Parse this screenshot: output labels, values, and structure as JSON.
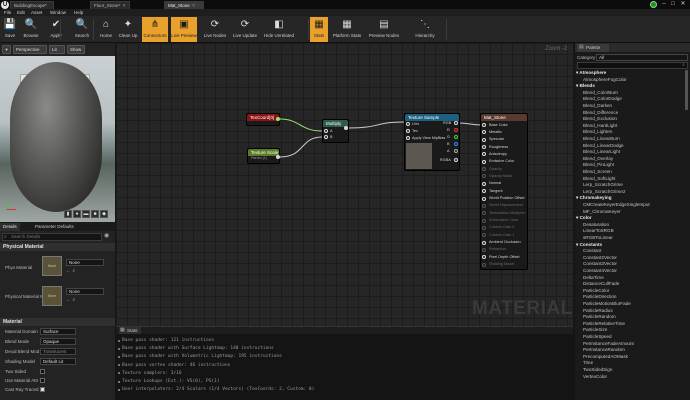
{
  "window": {
    "tabs": [
      {
        "label": "BuildingEscape*",
        "active": false
      },
      {
        "label": "Floor_Stone*",
        "active": false
      },
      {
        "label": "Mat_Stone",
        "active": true
      }
    ],
    "controls": {
      "minimize": "–",
      "maximize": "□",
      "close": "✕"
    }
  },
  "menu": {
    "items": [
      "File",
      "Edit",
      "Asset",
      "Window",
      "Help"
    ]
  },
  "toolbar": {
    "buttons": [
      {
        "label": "Save",
        "icon": "💾",
        "highlighted": false
      },
      {
        "label": "Browse",
        "icon": "🔍",
        "highlighted": false
      },
      {
        "label": "Apply",
        "icon": "✔",
        "highlighted": false
      },
      {
        "label": "Search",
        "icon": "🔍",
        "highlighted": false
      },
      {
        "label": "Home",
        "icon": "⌂",
        "highlighted": false
      },
      {
        "label": "Clean Up",
        "icon": "✦",
        "highlighted": false
      },
      {
        "label": "Connectors",
        "icon": "⋔",
        "highlighted": true
      },
      {
        "label": "Live Preview",
        "icon": "▣",
        "highlighted": true
      },
      {
        "label": "Live Nodes",
        "icon": "⟳",
        "highlighted": false
      },
      {
        "label": "Live Update",
        "icon": "⟳",
        "highlighted": false
      },
      {
        "label": "Hide Unrelated",
        "icon": "◧",
        "highlighted": false
      },
      {
        "label": "Stats",
        "icon": "▦",
        "highlighted": true
      },
      {
        "label": "Platform Stats",
        "icon": "▦",
        "highlighted": false
      },
      {
        "label": "Preview Nodes",
        "icon": "▤",
        "highlighted": false
      },
      {
        "label": "Hierarchy",
        "icon": "⋱",
        "highlighted": false
      }
    ]
  },
  "viewport": {
    "perspective_label": "Perspective",
    "lit_label": "Lit",
    "show_label": "Show"
  },
  "details": {
    "tabs": [
      {
        "label": "Details",
        "active": true
      },
      {
        "label": "Parameter Defaults",
        "active": false
      }
    ],
    "search_placeholder": "Search Details",
    "physical_material": {
      "header": "Physical Material",
      "rows": [
        {
          "label": "Phys Material",
          "thumb": "None",
          "value": "None"
        },
        {
          "label": "Physical Material M",
          "thumb": "None",
          "value": "None"
        }
      ]
    },
    "material": {
      "header": "Material",
      "rows": [
        {
          "label": "Material Domain",
          "value": "Surface"
        },
        {
          "label": "Blend Mode",
          "value": "Opaque"
        },
        {
          "label": "Decal Blend Mod",
          "value": "Translucent"
        },
        {
          "label": "Shading Model",
          "value": "Default Lit"
        },
        {
          "label": "Two Sided",
          "value": ""
        },
        {
          "label": "Use Material Attr",
          "value": ""
        },
        {
          "label": "Cast Ray Traced",
          "value": ""
        }
      ]
    }
  },
  "graph": {
    "zoom": "Zoom -2",
    "watermark": "MATERIAL",
    "nodes": {
      "texcoord": {
        "title": "TexCoord[0]"
      },
      "texturescale": {
        "title": "Texture Scale",
        "value": "Param (1)"
      },
      "multiply": {
        "title": "Multiply",
        "pins": [
          "A",
          "B"
        ]
      },
      "texturesample": {
        "title": "Texture Sample",
        "inputs": [
          "UVs",
          "Tex",
          "Apply View MipBias"
        ],
        "outputs": [
          "RGB",
          "R",
          "G",
          "B",
          "A",
          "RGBA"
        ]
      },
      "result": {
        "title": "Mat_Stone",
        "pins": [
          {
            "label": "Base Color",
            "active": true
          },
          {
            "label": "Metallic",
            "active": true
          },
          {
            "label": "Specular",
            "active": true
          },
          {
            "label": "Roughness",
            "active": true
          },
          {
            "label": "Anisotropy",
            "active": true
          },
          {
            "label": "Emissive Color",
            "active": true
          },
          {
            "label": "Opacity",
            "active": false
          },
          {
            "label": "Opacity Mask",
            "active": false
          },
          {
            "label": "Normal",
            "active": true
          },
          {
            "label": "Tangent",
            "active": true
          },
          {
            "label": "World Position Offset",
            "active": true
          },
          {
            "label": "World Displacement",
            "active": false
          },
          {
            "label": "Tessellation Multiplier",
            "active": false
          },
          {
            "label": "Subsurface Color",
            "active": false
          },
          {
            "label": "Custom Data 0",
            "active": false
          },
          {
            "label": "Custom Data 1",
            "active": false
          },
          {
            "label": "Ambient Occlusion",
            "active": true
          },
          {
            "label": "Refraction",
            "active": false
          },
          {
            "label": "Pixel Depth Offset",
            "active": true
          },
          {
            "label": "Shading Model",
            "active": false
          }
        ]
      }
    }
  },
  "stats": {
    "tab": "Stats",
    "lines": [
      "Base pass shader: 121 instructions",
      "Base pass shader with Surface Lightmap: 140 instructions",
      "Base pass shader with Volumetric Lightmap: 195 instructions",
      "Base pass vertex shader: 46 instructions",
      "Texture samplers: 3/16",
      "Texture Lookups (Est.): VS(0), PS(1)",
      "User interpolators: 2/4 Scalars (1/4 Vectors) (TexCoords: 2, Custom: 0)"
    ]
  },
  "palette": {
    "title": "Palette",
    "category_label": "Category",
    "category_value": "All",
    "search_placeholder": "",
    "groups": [
      {
        "name": "Atmosphere",
        "items": [
          "AtmosphereFogColor"
        ]
      },
      {
        "name": "Blends",
        "items": [
          "Blend_ColorBurn",
          "Blend_ColorDodge",
          "Blend_Darken",
          "Blend_Difference",
          "Blend_Exclusion",
          "Blend_HardLight",
          "Blend_Lighten",
          "Blend_LinearBurn",
          "Blend_LinearDodge",
          "Blend_LinearLight",
          "Blend_Overlay",
          "Blend_PinLight",
          "Blend_Screen",
          "Blend_SoftLight",
          "Lerp_ScratchGrime",
          "Lerp_ScratchGrime2"
        ]
      },
      {
        "name": "Chromakeying",
        "items": [
          "CMCreateKeyerEdgeSingleInput",
          "MF_ChromaKeyer"
        ]
      },
      {
        "name": "Color",
        "items": [
          "Desaturation",
          "LinearToSRGB",
          "sRGBToLinear"
        ]
      },
      {
        "name": "Constants",
        "items": [
          "Constant",
          "Constant2Vector",
          "Constant3Vector",
          "Constant4Vector",
          "DeltaTime",
          "DistanceCullFade",
          "ParticleColor",
          "ParticleDirection",
          "ParticleMotionBlurFade",
          "ParticleRadius",
          "ParticleRandom",
          "ParticleRelativeTime",
          "ParticleSize",
          "ParticleSpeed",
          "PerInstanceFadeAmount",
          "PerInstanceRandom",
          "PrecomputedAOMask",
          "Time",
          "TwoSidedSign",
          "VertexColor"
        ]
      }
    ]
  }
}
